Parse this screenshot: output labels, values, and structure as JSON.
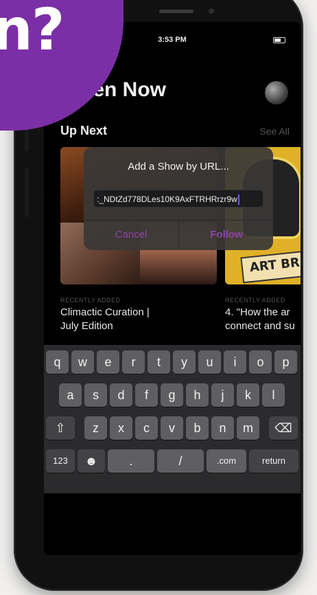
{
  "overlay": {
    "corner_text": "n?"
  },
  "status_bar": {
    "time": "3:53 PM"
  },
  "screen": {
    "title": "Listen Now",
    "section_title": "Up Next",
    "see_all": "See All"
  },
  "cards": [
    {
      "label": "RECENTLY ADDED",
      "title_line_1": "Climactic Curation |",
      "title_line_2": "July Edition"
    },
    {
      "label": "RECENTLY ADDED",
      "title_line_1": "4. \"How the ar",
      "title_line_2": "connect and su",
      "art_text": "ART   BR"
    }
  ],
  "dialog": {
    "title": "Add a Show by URL...",
    "input_value": ":_NDtZd778DLes10K9AxFTRHRrzr9w",
    "cancel_label": "Cancel",
    "follow_label": "Follow"
  },
  "keyboard": {
    "row1": [
      "q",
      "w",
      "e",
      "r",
      "t",
      "y",
      "u",
      "i",
      "o",
      "p"
    ],
    "row2": [
      "a",
      "s",
      "d",
      "f",
      "g",
      "h",
      "j",
      "k",
      "l"
    ],
    "row3_letters": [
      "z",
      "x",
      "c",
      "v",
      "b",
      "n",
      "m"
    ],
    "shift": "⇧",
    "delete": "⌫",
    "numbers": "123",
    "emoji": "☻",
    "dot": ".",
    "slash": "/",
    "dotcom": ".com",
    "return": "return"
  },
  "colors": {
    "accent": "#8e44ad",
    "purple_overlay": "#7b2fa6",
    "background": "#f1f0ef"
  }
}
